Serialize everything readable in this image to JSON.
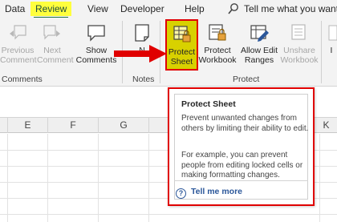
{
  "tabs": [
    {
      "label": "Data"
    },
    {
      "label": "Review"
    },
    {
      "label": "View"
    },
    {
      "label": "Developer"
    },
    {
      "label": "Help"
    }
  ],
  "tell_me": "Tell me what you want to",
  "ribbon": {
    "previous_comment": {
      "line1": "Previous",
      "line2": "Comment"
    },
    "next_comment": {
      "line1": "Next",
      "line2": "Comment"
    },
    "show_comments": {
      "line1": "Show",
      "line2": "Comments"
    },
    "notes": {
      "line1": "N",
      "line2": ""
    },
    "protect_sheet": {
      "line1": "Protect",
      "line2": "Sheet"
    },
    "protect_workbook": {
      "line1": "Protect",
      "line2": "Workbook"
    },
    "allow_edit_ranges": {
      "line1": "Allow Edit",
      "line2": "Ranges"
    },
    "unshare_workbook": {
      "line1": "Unshare",
      "line2": "Workbook"
    },
    "ink": {
      "line1": "I",
      "line2": ""
    },
    "groups": {
      "comments": "Comments",
      "notes": "Notes",
      "protect": "Protect"
    }
  },
  "columns": [
    "E",
    "F",
    "G",
    "K"
  ],
  "tooltip": {
    "title": "Protect Sheet",
    "desc": "Prevent unwanted changes from others by limiting their ability to edit.",
    "example": "For example, you can prevent people from editing locked cells or making formatting changes.",
    "link": "Tell me more"
  },
  "colors": {
    "review_highlight": "#ffff3d",
    "protect_highlight": "#d8d100",
    "annotation_red": "#e00000",
    "link_blue": "#2b579a"
  }
}
